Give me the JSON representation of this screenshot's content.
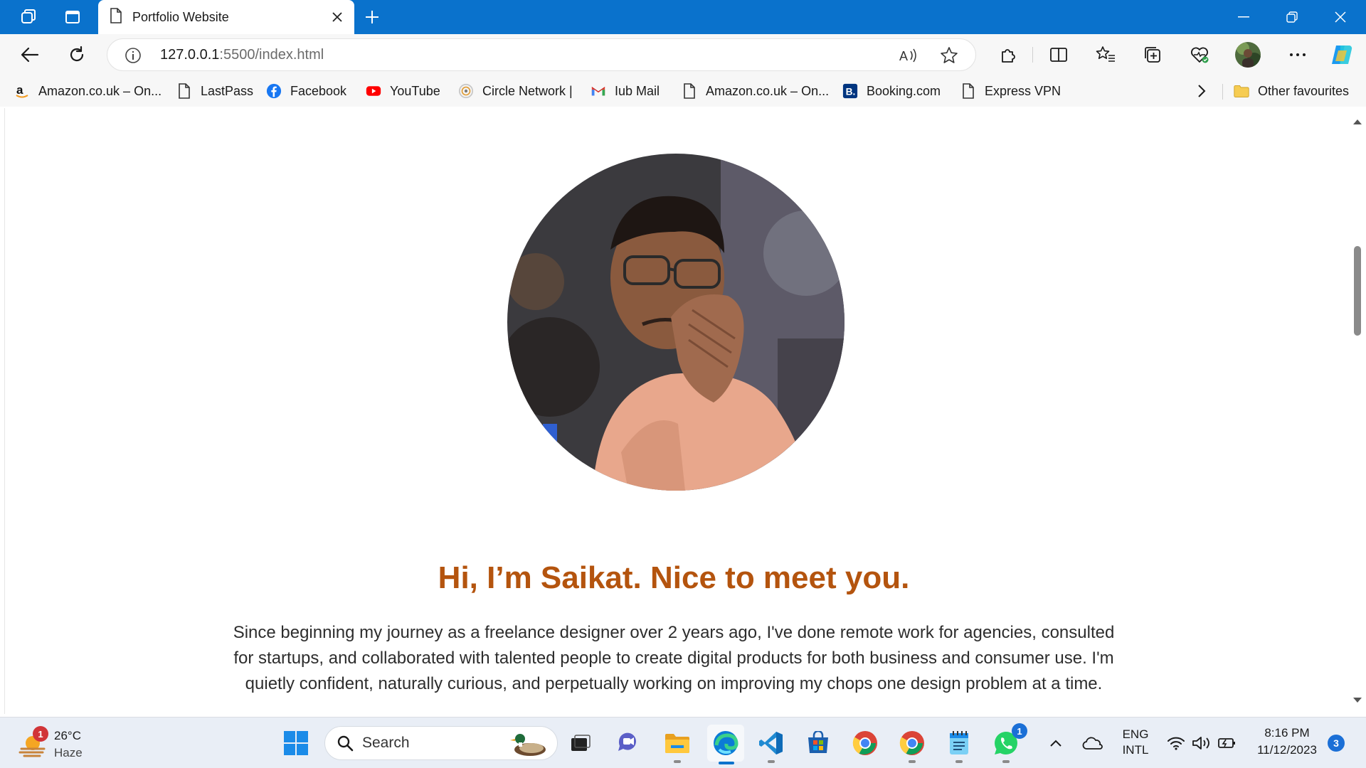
{
  "browser": {
    "tab": {
      "title": "Portfolio Website"
    },
    "address": {
      "host": "127.0.0.1",
      "path": ":5500/index.html"
    },
    "window_controls": [
      "minimize-icon",
      "restore-icon",
      "close-icon"
    ],
    "toolbar_icons": [
      "read-aloud-icon",
      "favorite-star-icon",
      "extensions-icon",
      "split-screen-icon",
      "favorites-icon",
      "collections-icon",
      "browser-essentials-icon",
      "profile-avatar",
      "more-icon",
      "copilot-icon"
    ]
  },
  "favourites": [
    {
      "label": "Amazon.co.uk – On...",
      "icon": "amazon-icon"
    },
    {
      "label": "LastPass",
      "icon": "page-icon"
    },
    {
      "label": "Facebook",
      "icon": "facebook-icon"
    },
    {
      "label": "YouTube",
      "icon": "youtube-icon"
    },
    {
      "label": "Circle Network |",
      "icon": "circle-network-icon"
    },
    {
      "label": "Iub Mail",
      "icon": "gmail-icon"
    },
    {
      "label": "Amazon.co.uk – On...",
      "icon": "page-icon"
    },
    {
      "label": "Booking.com",
      "icon": "booking-icon"
    },
    {
      "label": "Express VPN",
      "icon": "page-icon"
    }
  ],
  "other_favourites": "Other favourites",
  "page": {
    "heading": "Hi, I’m Saikat. Nice to meet you.",
    "bio": "Since beginning my journey as a freelance designer over 2 years ago, I've done remote work for agencies, consulted for startups, and collaborated with talented people to create digital products for both business and consumer use. I'm quietly confident, naturally curious, and perpetually working on improving my chops one design problem at a time.",
    "colors": {
      "heading": "#b4540e",
      "body_text": "#2d2d2d"
    }
  },
  "taskbar": {
    "weather": {
      "temp": "26°C",
      "condition": "Haze",
      "badge": "1"
    },
    "search_label": "Search",
    "whatsapp_badge": "1",
    "language": {
      "line1": "ENG",
      "line2": "INTL"
    },
    "clock": {
      "time": "8:16 PM",
      "date": "11/12/2023"
    },
    "notification_count": "3"
  }
}
